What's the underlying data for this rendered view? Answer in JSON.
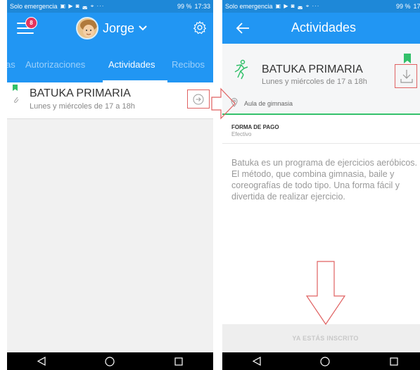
{
  "left_screen": {
    "statusbar": {
      "carrier": "Solo emergencia",
      "signal_icons": "▣ ▶ ◙ ◛ ⌖ ···",
      "battery": "99 %",
      "time": "17:33"
    },
    "appbar": {
      "notification_count": "8",
      "user_name": "Jorge"
    },
    "tabs": [
      "as",
      "Autorizaciones",
      "Actividades",
      "Recibos"
    ],
    "activity": {
      "title": "BATUKA PRIMARIA",
      "schedule": "Lunes y miércoles de 17 a 18h"
    }
  },
  "right_screen": {
    "statusbar": {
      "carrier": "Solo emergencia",
      "signal_icons": "▣ ▶ ◙ ◛ ⌖ ···",
      "battery": "99 %",
      "time": "17:3"
    },
    "appbar": {
      "title": "Actividades"
    },
    "detail": {
      "title": "BATUKA PRIMARIA",
      "schedule": "Lunes y miércoles de 17 a 18h",
      "location": "Aula de gimnasia",
      "payment_label": "FORMA DE PAGO",
      "payment_value": "Efectivo",
      "description": "Batuka es un programa de ejercicios aeróbicos. El método, que combina gimnasia, baile y coreografías de todo tipo. Una forma fácil y divertida de realizar ejercicio."
    },
    "enroll_button": {
      "label": "YA ESTÁS INSCRITO"
    }
  },
  "colors": {
    "primary": "#2196f3",
    "accent_green": "#33c06a",
    "badge_red": "#e5345d",
    "annotation_red": "#e06262"
  },
  "icons": [
    "menu-icon",
    "settings-icon",
    "chevron-down-icon",
    "bookmark-icon",
    "paperclip-icon",
    "arrow-right-circle-icon",
    "back-arrow-icon",
    "dance-icon",
    "download-icon",
    "location-pin-icon",
    "nav-back-icon",
    "nav-home-icon",
    "nav-recents-icon"
  ]
}
